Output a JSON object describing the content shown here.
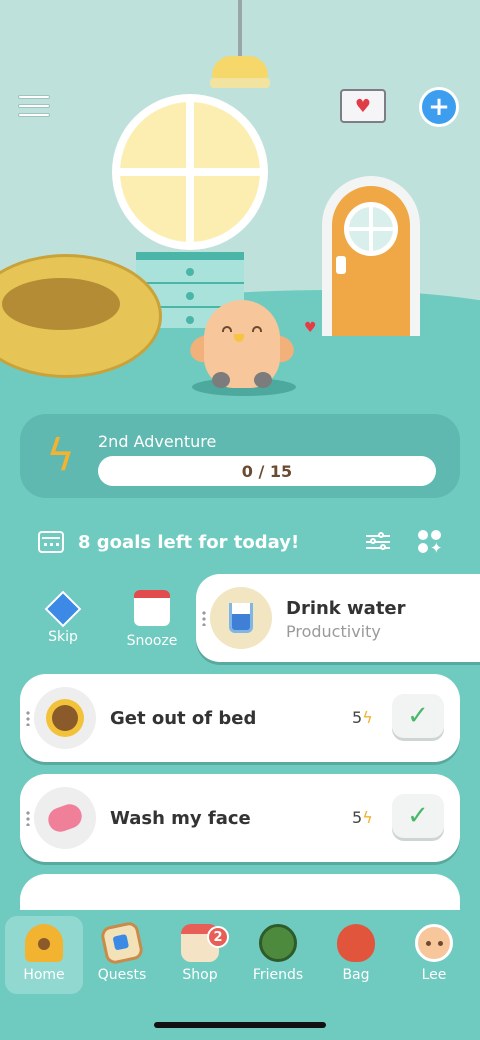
{
  "header": {
    "menu_icon": "hamburger-menu-icon",
    "mail_icon": "envelope-heart-icon",
    "add_icon": "plus-badge-icon"
  },
  "adventure": {
    "title": "2nd Adventure",
    "progress_text": "0 / 15",
    "progress_value": 0,
    "progress_max": 15,
    "icon": "lightning-bolt-icon"
  },
  "goals_header": {
    "text": "8 goals left for today!",
    "calendar_icon": "calendar-icon",
    "filter_icon": "sliders-icon",
    "grid_icon": "grid-sparkle-icon"
  },
  "swipe_actions": {
    "skip_label": "Skip",
    "snooze_label": "Snooze"
  },
  "goals": [
    {
      "name": "Drink water",
      "category": "Productivity",
      "icon": "water-glass-icon"
    },
    {
      "name": "Get out of bed",
      "points": "5",
      "icon": "sunflower-icon",
      "check": "✓"
    },
    {
      "name": "Wash my face",
      "points": "5",
      "icon": "soap-icon",
      "check": "✓"
    }
  ],
  "bolt_glyph": "ϟ",
  "nav": {
    "items": [
      {
        "label": "Home",
        "icon": "birdhouse-icon"
      },
      {
        "label": "Quests",
        "icon": "quest-scroll-icon"
      },
      {
        "label": "Shop",
        "icon": "shop-icon",
        "badge": "2"
      },
      {
        "label": "Friends",
        "icon": "tree-icon"
      },
      {
        "label": "Bag",
        "icon": "bag-icon"
      },
      {
        "label": "Lee",
        "icon": "avatar-icon"
      }
    ]
  },
  "colors": {
    "teal": "#6fcbc0",
    "accent_yellow": "#f2b330",
    "check_green": "#4ab86b",
    "badge_red": "#e85f57"
  }
}
